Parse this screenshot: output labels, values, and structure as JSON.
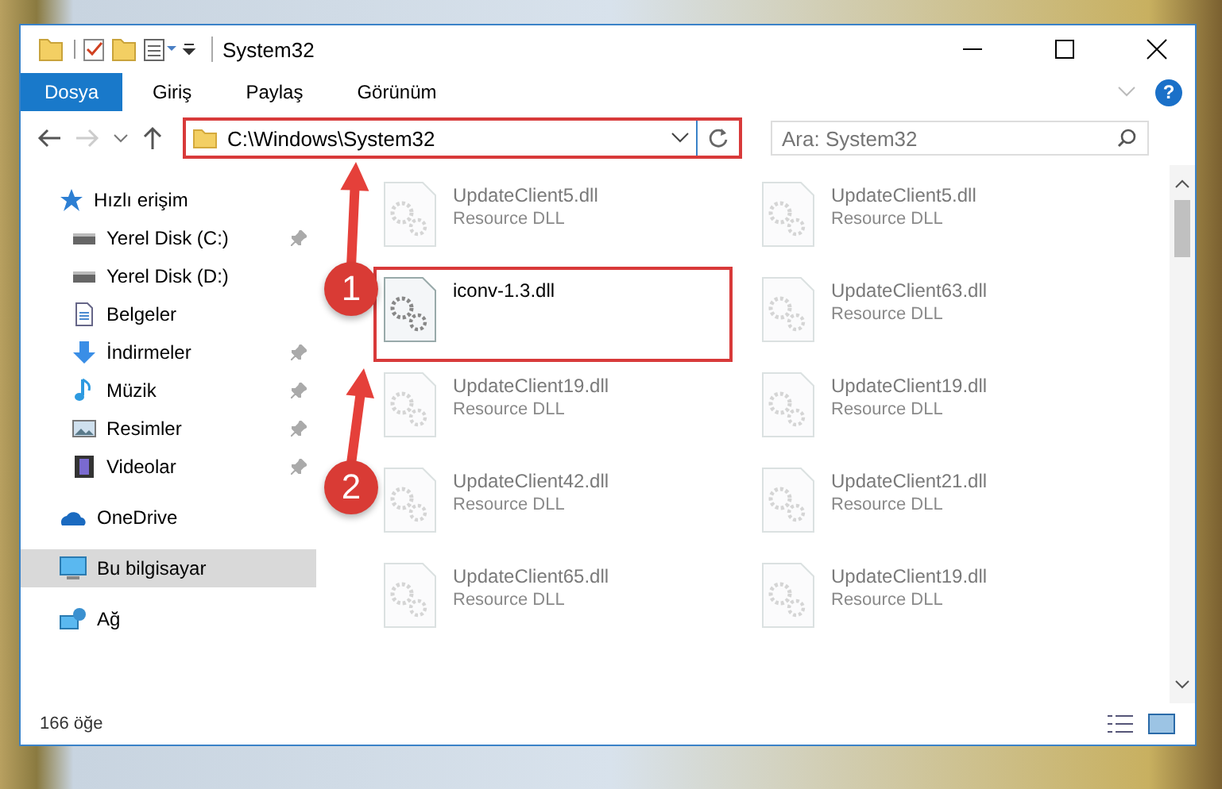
{
  "window": {
    "title": "System32"
  },
  "ribbon_tabs": [
    {
      "label": "Dosya",
      "selected": true
    },
    {
      "label": "Giriş",
      "selected": false
    },
    {
      "label": "Paylaş",
      "selected": false
    },
    {
      "label": "Görünüm",
      "selected": false
    }
  ],
  "help_button": "?",
  "address_bar": {
    "path": "C:\\Windows\\System32",
    "highlighted": true
  },
  "search": {
    "placeholder": "Ara: System32"
  },
  "sidebar": {
    "items": [
      {
        "label": "Hızlı erişim",
        "kind": "star",
        "pinned": false,
        "selected": false
      },
      {
        "label": "Yerel Disk (C:)",
        "kind": "drive",
        "pinned": true,
        "selected": false
      },
      {
        "label": "Yerel Disk (D:)",
        "kind": "drive",
        "pinned": false,
        "selected": false
      },
      {
        "label": "Belgeler",
        "kind": "document",
        "pinned": false,
        "selected": false
      },
      {
        "label": "İndirmeler",
        "kind": "download",
        "pinned": true,
        "selected": false
      },
      {
        "label": "Müzik",
        "kind": "music",
        "pinned": true,
        "selected": false
      },
      {
        "label": "Resimler",
        "kind": "pictures",
        "pinned": true,
        "selected": false
      },
      {
        "label": "Videolar",
        "kind": "video",
        "pinned": true,
        "selected": false
      },
      {
        "label": "OneDrive",
        "kind": "cloud",
        "pinned": false,
        "selected": false
      },
      {
        "label": "Bu bilgisayar",
        "kind": "computer",
        "pinned": false,
        "selected": true
      },
      {
        "label": "Ağ",
        "kind": "network",
        "pinned": false,
        "selected": false
      }
    ]
  },
  "files": [
    {
      "name": "UpdateClient5.dll",
      "type": "Resource DLL",
      "blurred": true,
      "highlighted": false
    },
    {
      "name": "UpdateClient5.dll",
      "type": "Resource DLL",
      "blurred": true,
      "highlighted": false
    },
    {
      "name": "iconv-1.3.dll",
      "blurred": false,
      "highlighted": true
    },
    {
      "name": "UpdateClient63.dll",
      "type": "Resource DLL",
      "blurred": true,
      "highlighted": false
    },
    {
      "name": "UpdateClient19.dll",
      "type": "Resource DLL",
      "blurred": true,
      "highlighted": false
    },
    {
      "name": "UpdateClient19.dll",
      "type": "Resource DLL",
      "blurred": true,
      "highlighted": false
    },
    {
      "name": "UpdateClient42.dll",
      "type": "Resource DLL",
      "blurred": true,
      "highlighted": false
    },
    {
      "name": "UpdateClient21.dll",
      "type": "Resource DLL",
      "blurred": true,
      "highlighted": false
    },
    {
      "name": "UpdateClient65.dll",
      "type": "Resource DLL",
      "blurred": true,
      "highlighted": false
    },
    {
      "name": "UpdateClient19.dll",
      "type": "Resource DLL",
      "blurred": true,
      "highlighted": false
    }
  ],
  "status_bar": {
    "item_count": "166 öğe"
  },
  "callouts": [
    {
      "number": "1"
    },
    {
      "number": "2"
    }
  ]
}
